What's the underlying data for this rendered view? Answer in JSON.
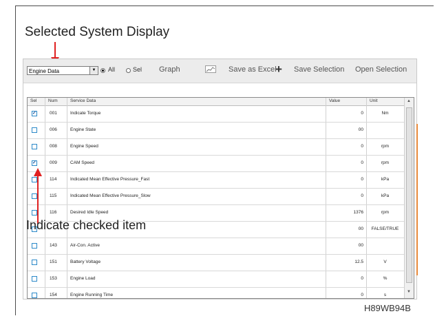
{
  "callouts": {
    "top": "Selected System Display",
    "bottom": "Indicate checked item",
    "code": "H89WB94B"
  },
  "toolbar": {
    "system_select": "Engine Data",
    "radio_all": "All",
    "radio_sel": "Sel",
    "radio_selected": "All",
    "graph": "Graph",
    "save_excel": "Save as Excel",
    "save_selection": "Save Selection",
    "open_selection": "Open Selection"
  },
  "table": {
    "headers": [
      "Sel",
      "Num",
      "Service Data",
      "Value",
      "Unit"
    ],
    "rows": [
      {
        "checked": true,
        "num": "001",
        "name": "Indicate Torque",
        "value": "0",
        "unit": "Nm"
      },
      {
        "checked": false,
        "num": "006",
        "name": "Engine State",
        "value": "00",
        "unit": ""
      },
      {
        "checked": false,
        "num": "008",
        "name": "Engine Speed",
        "value": "0",
        "unit": "rpm"
      },
      {
        "checked": true,
        "num": "009",
        "name": "CAM Speed",
        "value": "0",
        "unit": "rpm"
      },
      {
        "checked": false,
        "num": "114",
        "name": "Indicated Mean Effective Pressure_Fast",
        "value": "0",
        "unit": "kPa"
      },
      {
        "checked": false,
        "num": "115",
        "name": "Indicated Mean Effective Pressure_Slow",
        "value": "0",
        "unit": "kPa"
      },
      {
        "checked": false,
        "num": "116",
        "name": "Desired Idle Speed",
        "value": "1376",
        "unit": "rpm"
      },
      {
        "checked": false,
        "num": "",
        "name": "",
        "value": "00",
        "unit": "FALSE/TRUE"
      },
      {
        "checked": false,
        "num": "143",
        "name": "Air-Con. Active",
        "value": "00",
        "unit": ""
      },
      {
        "checked": false,
        "num": "151",
        "name": "Battery Voltage",
        "value": "12.5",
        "unit": "V"
      },
      {
        "checked": false,
        "num": "153",
        "name": "Engine Load",
        "value": "0",
        "unit": "%"
      },
      {
        "checked": false,
        "num": "154",
        "name": "Engine Running Time",
        "value": "0",
        "unit": "s"
      }
    ]
  },
  "colors": {
    "arrow": "#e02020",
    "checkbox": "#2a88c8"
  }
}
